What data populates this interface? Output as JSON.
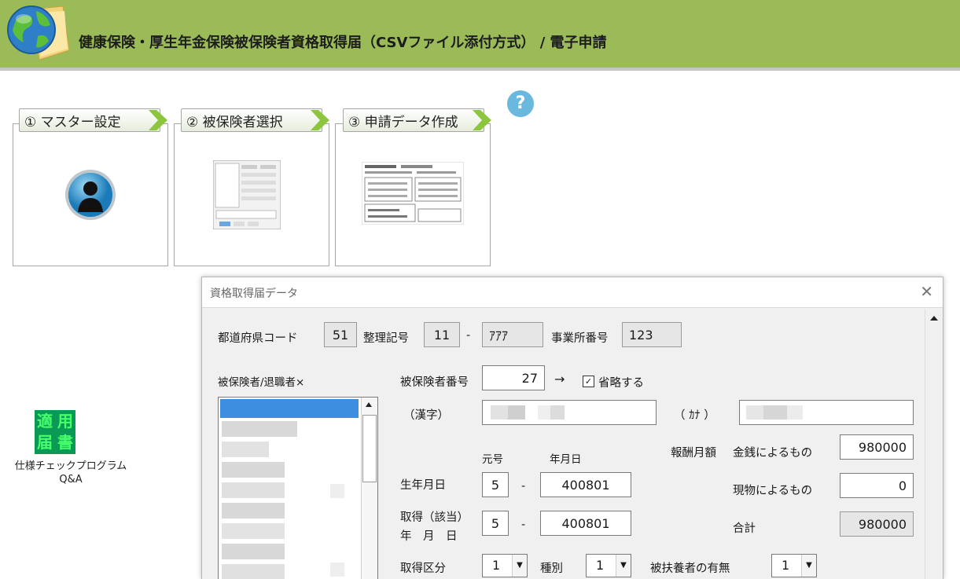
{
  "header": {
    "title": "健康保険・厚生年金保険被保険者資格取得届（CSVファイル添付方式） / 電子申請"
  },
  "steps": [
    {
      "label": "① マスター設定"
    },
    {
      "label": "② 被保険者選択"
    },
    {
      "label": "③ 申請データ作成"
    }
  ],
  "help": {
    "symbol": "?"
  },
  "sidebar": {
    "icon_text": [
      "適",
      "用",
      "届",
      "書"
    ],
    "label_line1": "仕様チェックプログラム",
    "label_line2": "Q&A"
  },
  "dialog": {
    "title": "資格取得届データ",
    "close_symbol": "✕",
    "prefecture_label": "都道府県コード",
    "prefecture_value": "51",
    "seiri_label": "整理記号",
    "seiri_value1": "11",
    "dash": "-",
    "seiri_value2": "ｱｱｱ",
    "office_label": "事業所番号",
    "office_value": "123",
    "list_label": "被保険者/退職者×",
    "insured_no_label": "被保険者番号",
    "insured_no_value": "27",
    "arrow": "→",
    "omit_checked": true,
    "omit_check_mark": "✓",
    "omit_label": "省略する",
    "kanji_label": "（漢字）",
    "kana_label": "（ ｶﾅ ）",
    "era_header": "元号",
    "ymd_header": "年月日",
    "birth_label": "生年月日",
    "birth_era": "5",
    "birth_date": "400801",
    "acq_label_line1": "取得（該当）",
    "acq_label_line2": "年　月　日",
    "acq_era": "5",
    "acq_date": "400801",
    "reward_label": "報酬月額",
    "money_label": "金銭によるもの",
    "money_value": "980000",
    "inkind_label": "現物によるもの",
    "inkind_value": "0",
    "total_label": "合計",
    "total_value": "980000",
    "acq_class_label": "取得区分",
    "acq_class_value": "1",
    "type_label": "種別",
    "type_value": "1",
    "dependent_label": "被扶養者の有無",
    "dependent_value": "1"
  },
  "colors": {
    "header_bg": "#9bbb59",
    "list_selection": "#3d8ee0",
    "help_icon": "#6ab8de",
    "step_arrow": "#8cc63f"
  }
}
